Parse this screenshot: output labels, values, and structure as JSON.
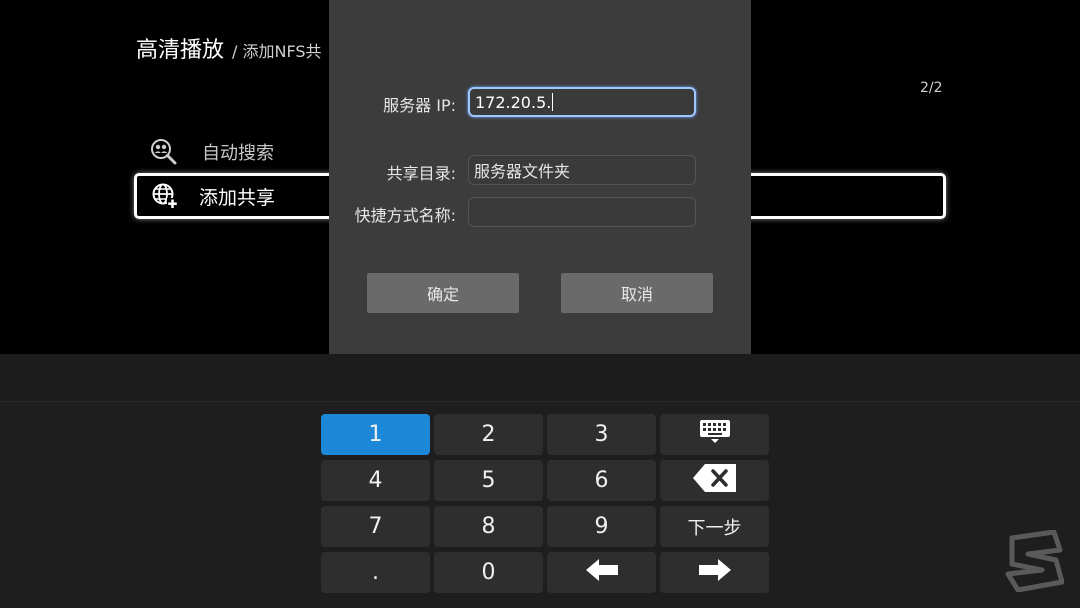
{
  "header": {
    "title": "高清播放",
    "breadcrumb": "/ 添加NFS共"
  },
  "page_indicator": "2/2",
  "menu": {
    "items": [
      {
        "label": "自动搜索",
        "icon": "people-search-icon"
      },
      {
        "label": "添加共享",
        "icon": "globe-add-icon"
      }
    ]
  },
  "dialog": {
    "server_ip_label": "服务器 IP:",
    "server_ip_value": "172.20.5.",
    "share_dir_label": "共享目录:",
    "share_dir_placeholder": "服务器文件夹",
    "shortcut_label": "快捷方式名称:",
    "shortcut_value": "",
    "confirm_label": "确定",
    "cancel_label": "取消"
  },
  "keyboard": {
    "keys": [
      "1",
      "2",
      "3",
      "4",
      "5",
      "6",
      "7",
      "8",
      "9",
      ".",
      "0"
    ],
    "next_label": "下一步",
    "selected_key": "1",
    "icons": {
      "toggle": "keyboard-icon",
      "backspace": "backspace-icon",
      "left": "arrow-left-icon",
      "right": "arrow-right-icon"
    }
  },
  "colors": {
    "selected_key": "#1e88d8",
    "dialog_bg": "#3c3c3c",
    "active_input_border": "#9cc7ff"
  }
}
